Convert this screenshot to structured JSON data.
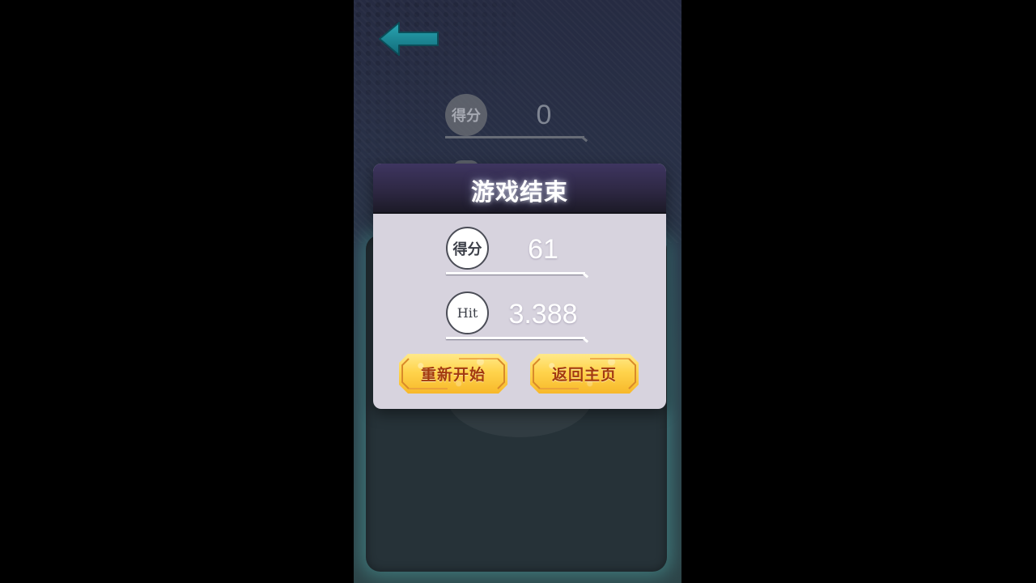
{
  "background": {
    "score_label": "得分",
    "score_value": "0"
  },
  "dialog": {
    "title": "游戏结束",
    "score": {
      "label": "得分",
      "value": "61"
    },
    "hit": {
      "label": "Hit",
      "value": "3.388"
    },
    "buttons": {
      "restart": "重新开始",
      "home": "返回主页"
    }
  },
  "icons": {
    "back": "back-arrow-icon"
  },
  "colors": {
    "accent_teal": "#1a8a96",
    "button_gold": "#ffd44c",
    "button_text": "#a33a10",
    "dialog_header": "#2e2844"
  }
}
